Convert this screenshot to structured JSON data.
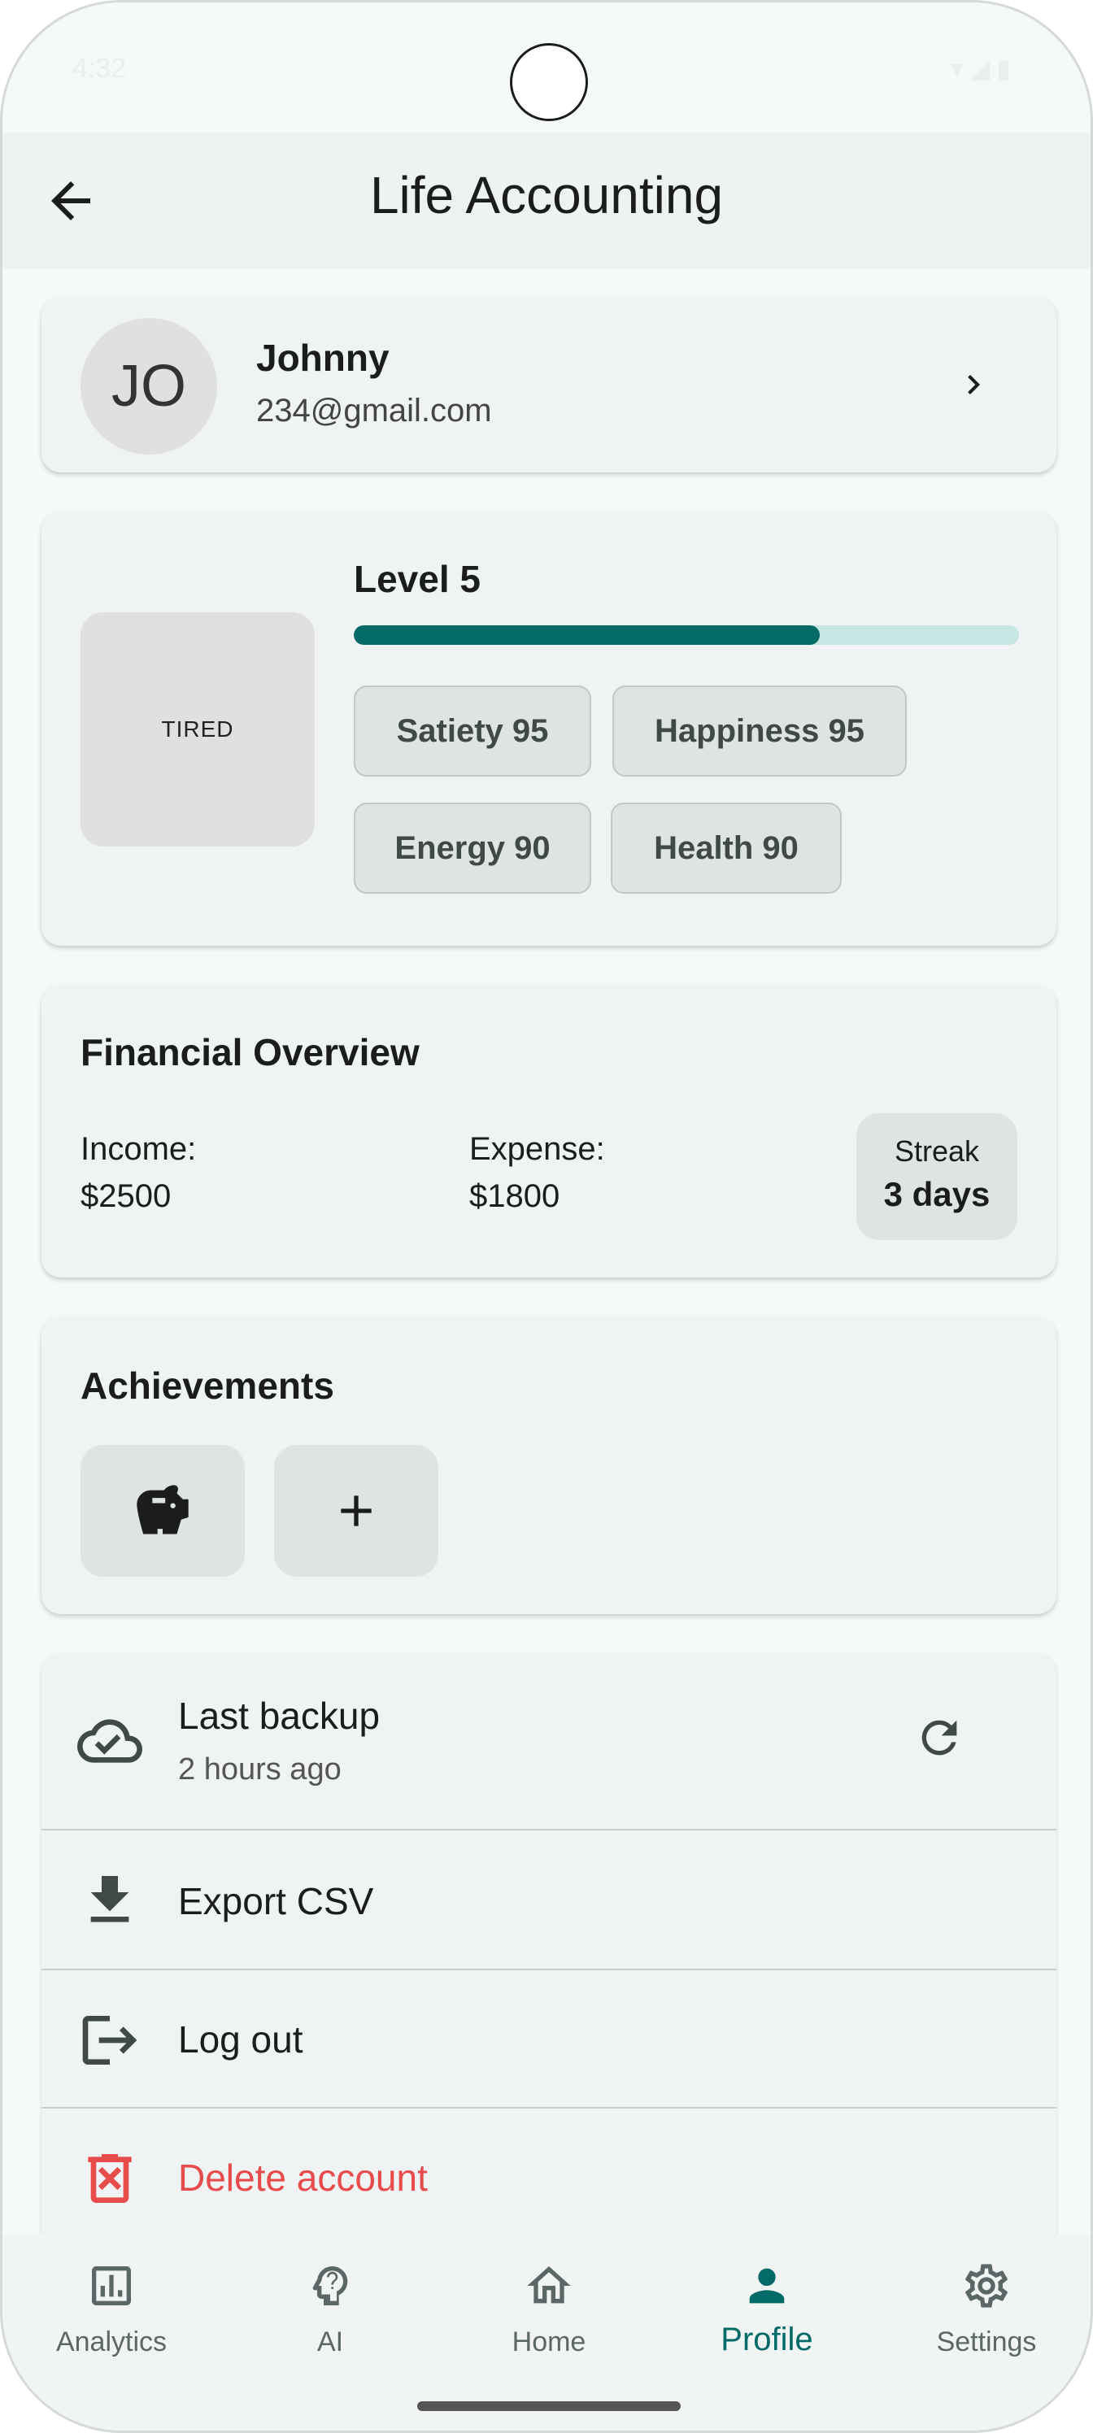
{
  "status_bar": {
    "time": "4:32"
  },
  "header": {
    "title": "Life Accounting"
  },
  "profile": {
    "initials": "JO",
    "name": "Johnny",
    "email": "234@gmail.com"
  },
  "pet": {
    "mood": "TIRED",
    "level_label": "Level 5",
    "level_progress": 0.7,
    "stats": [
      {
        "label": "Satiety 95"
      },
      {
        "label": "Happiness 95"
      },
      {
        "label": "Energy 90"
      },
      {
        "label": "Health 90"
      }
    ]
  },
  "finance": {
    "title": "Financial Overview",
    "income_label": "Income:",
    "income_value": "$2500",
    "expense_label": "Expense:",
    "expense_value": "$1800",
    "streak_label": "Streak",
    "streak_value": "3 days"
  },
  "achievements": {
    "title": "Achievements",
    "items": [
      "piggy-bank-icon",
      "plus-icon"
    ]
  },
  "actions": {
    "backup_title": "Last backup",
    "backup_sub": "2 hours ago",
    "export": "Export CSV",
    "logout": "Log out",
    "delete": "Delete account"
  },
  "nav": [
    {
      "label": "Analytics",
      "icon": "analytics-icon"
    },
    {
      "label": "AI",
      "icon": "ai-icon"
    },
    {
      "label": "Home",
      "icon": "home-icon"
    },
    {
      "label": "Profile",
      "icon": "profile-icon",
      "active": true
    },
    {
      "label": "Settings",
      "icon": "settings-icon"
    }
  ],
  "colors": {
    "accent": "#036b67",
    "danger": "#e84b4b",
    "progress_track": "#c8e6e3"
  }
}
